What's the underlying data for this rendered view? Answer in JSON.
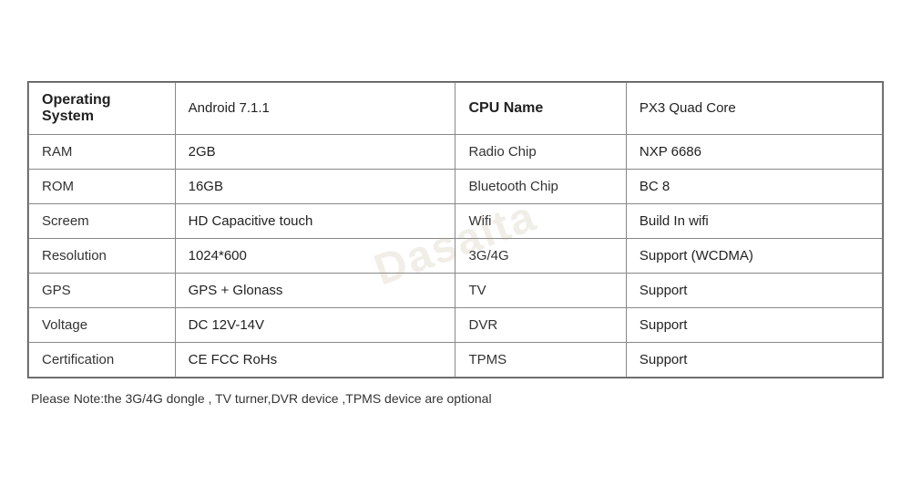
{
  "watermark": "Dasaita",
  "table": {
    "header": {
      "os_label": "Operating System",
      "os_value": "Android 7.1.1",
      "cpu_label": "CPU Name",
      "cpu_value": "PX3 Quad Core"
    },
    "rows": [
      {
        "left_label": "RAM",
        "left_value": "2GB",
        "right_label": "Radio Chip",
        "right_value": "NXP 6686"
      },
      {
        "left_label": "ROM",
        "left_value": "16GB",
        "right_label": "Bluetooth Chip",
        "right_value": "BC 8"
      },
      {
        "left_label": "Screem",
        "left_value": "HD Capacitive touch",
        "right_label": "Wifi",
        "right_value": "Build In wifi"
      },
      {
        "left_label": "Resolution",
        "left_value": "1024*600",
        "right_label": "3G/4G",
        "right_value": "Support (WCDMA)"
      },
      {
        "left_label": "GPS",
        "left_value": "GPS + Glonass",
        "right_label": "TV",
        "right_value": "Support"
      },
      {
        "left_label": "Voltage",
        "left_value": "DC 12V-14V",
        "right_label": "DVR",
        "right_value": "Support"
      },
      {
        "left_label": "Certification",
        "left_value": "CE FCC RoHs",
        "right_label": "TPMS",
        "right_value": "Support"
      }
    ]
  },
  "note": "Please Note:the 3G/4G dongle , TV turner,DVR device ,TPMS device are optional"
}
